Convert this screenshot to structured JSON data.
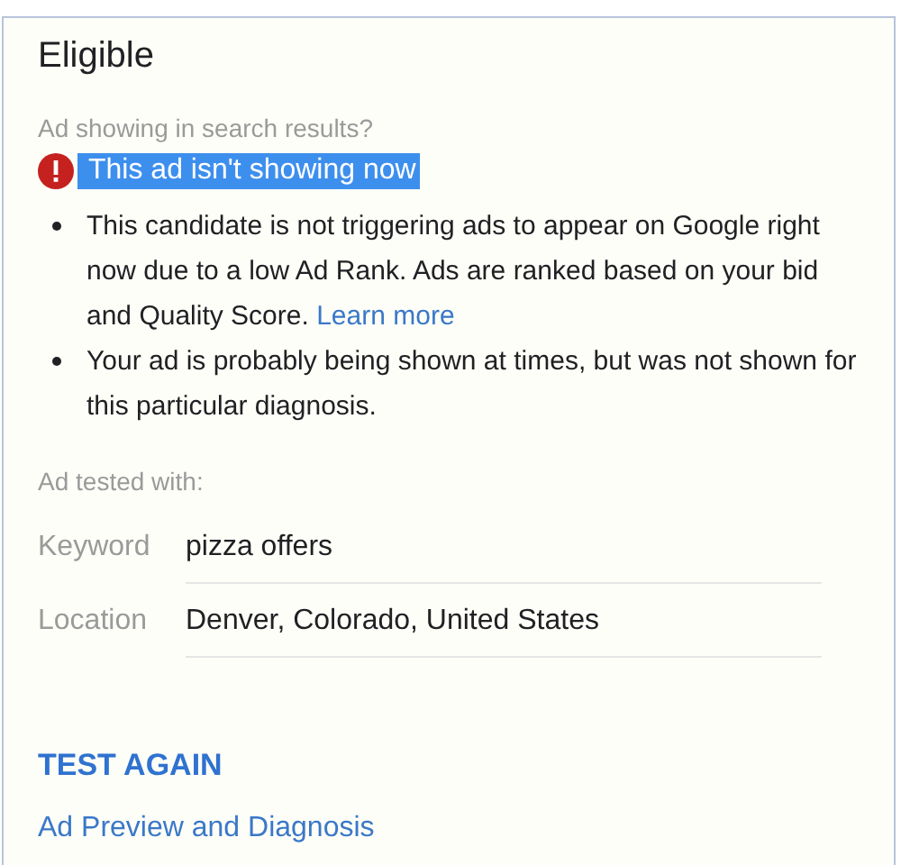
{
  "title": "Eligible",
  "question": "Ad showing in search results?",
  "status": {
    "text": "This ad isn't showing now",
    "highlighted": true
  },
  "bullets": [
    {
      "text": "This candidate is not triggering ads to appear on Google right now due to a low Ad Rank. Ads are ranked based on your bid and Quality Score.",
      "link": "Learn more"
    },
    {
      "text": "Your ad is probably being shown at times, but was not shown for this particular diagnosis."
    }
  ],
  "tested_label": "Ad tested with:",
  "fields": [
    {
      "label": "Keyword",
      "value": "pizza offers"
    },
    {
      "label": "Location",
      "value": "Denver, Colorado, United States"
    }
  ],
  "action_button": "TEST AGAIN",
  "footer_link": "Ad Preview and Diagnosis"
}
